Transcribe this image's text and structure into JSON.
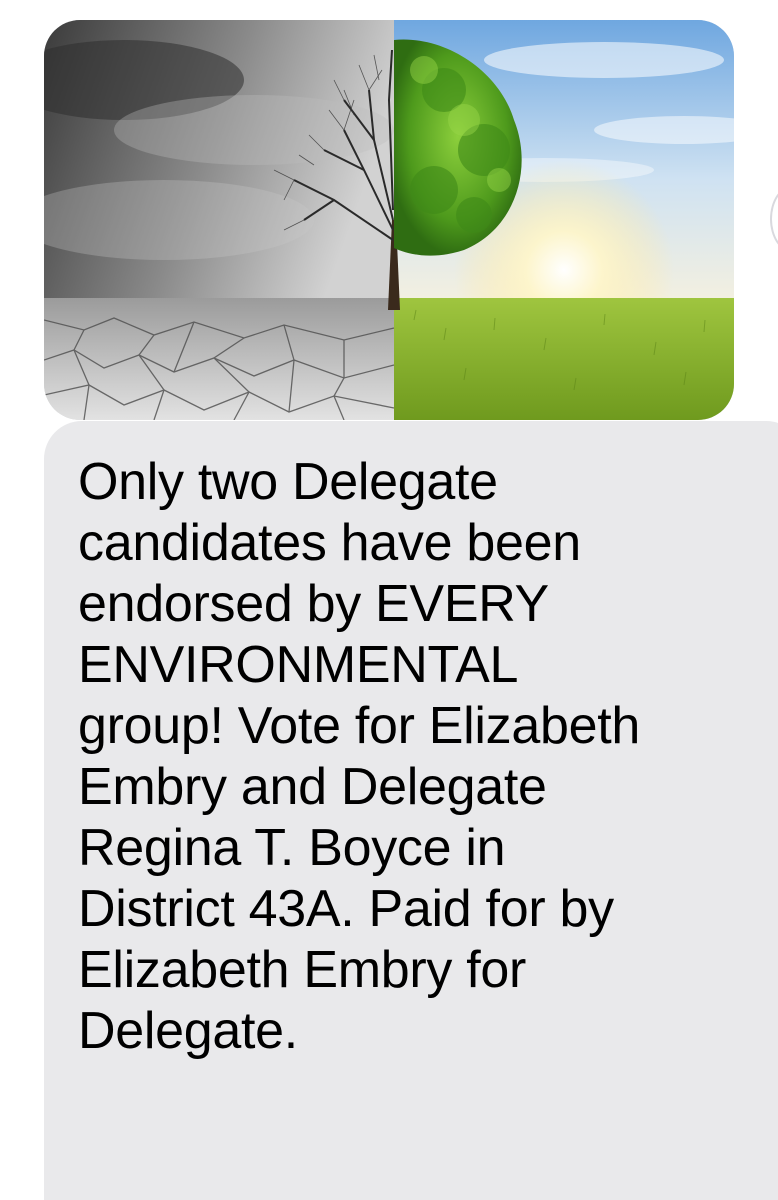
{
  "conversation": {
    "image_message": {
      "image_icon": "tree-half-barren-half-lush-image"
    },
    "text_message": {
      "text": "Only two Delegate\ncandidates have been\nendorsed by EVERY\nENVIRONMENTAL\ngroup! Vote for Elizabeth\nEmbry and Delegate\nRegina T. Boyce in\nDistrict 43A. Paid for by\nElizabeth Embry for\nDelegate."
    }
  },
  "colors": {
    "incoming_bubble": "#e9e9eb",
    "message_text": "#000000",
    "background": "#ffffff"
  }
}
